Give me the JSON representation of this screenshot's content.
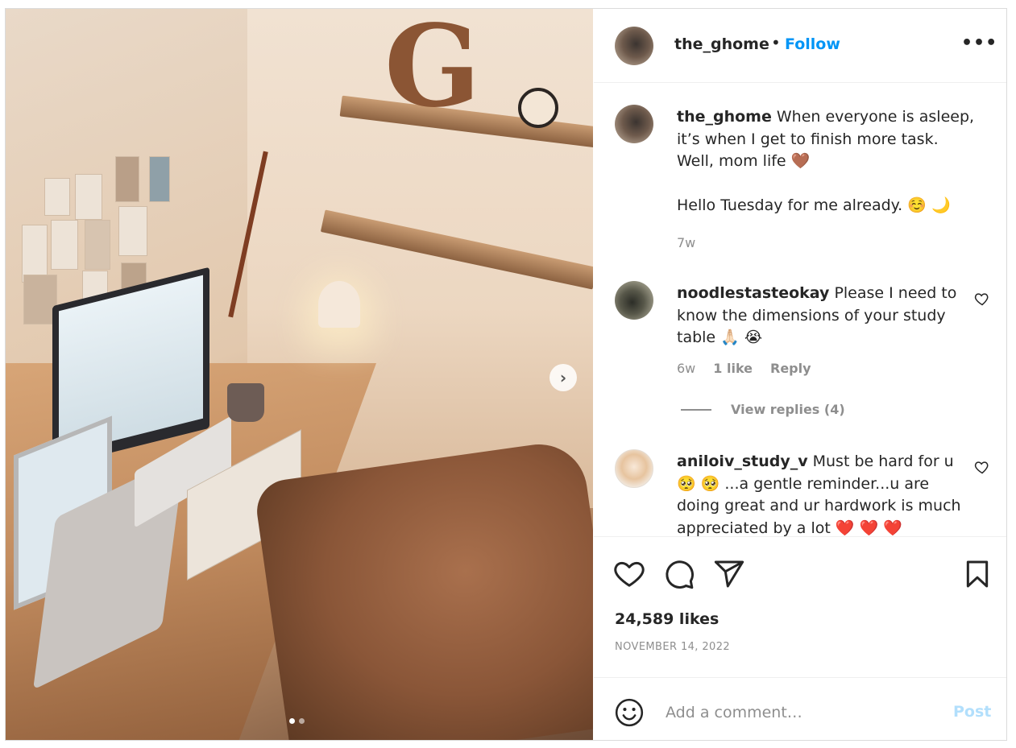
{
  "post": {
    "username": "the_ghome",
    "separator": "•",
    "follow_label": "Follow",
    "more_label": "•••",
    "photo": {
      "next_label": "›",
      "carousel_count": 2,
      "carousel_active": 1
    }
  },
  "comments": [
    {
      "username": "the_ghome",
      "text_line1": "When everyone is asleep, it’s when I get to finish more task. Well, mom life 🤎",
      "text_line2": "Hello Tuesday for me already. ☺️ 🌙",
      "time": "7w"
    },
    {
      "username": "noodlestasteokay",
      "text": "Please I need to know the dimensions of your study table 🙏🏻 😭",
      "time": "6w",
      "likes": "1 like",
      "reply_label": "Reply",
      "view_replies": "View replies (4)"
    },
    {
      "username": "aniloiv_study_v",
      "text": "Must be hard for u 🥺 🥺 ...a gentle reminder...u are doing great and ur hardwork is much appreciated by a lot ❤️ ❤️ ❤️"
    }
  ],
  "actions": {
    "likes": "24,589 likes",
    "date": "NOVEMBER 14, 2022"
  },
  "add_comment": {
    "placeholder": "Add a comment…",
    "post_label": "Post"
  },
  "icons": {
    "more": "more-icon",
    "like": "heart-icon",
    "comment": "comment-icon",
    "share": "share-icon",
    "save": "bookmark-icon",
    "emoji": "emoji-icon",
    "next": "chevron-right-icon"
  },
  "colors": {
    "accent": "#0095f6",
    "post_disabled": "#b2dffc",
    "muted": "#8e8e8e",
    "text": "#262626"
  }
}
